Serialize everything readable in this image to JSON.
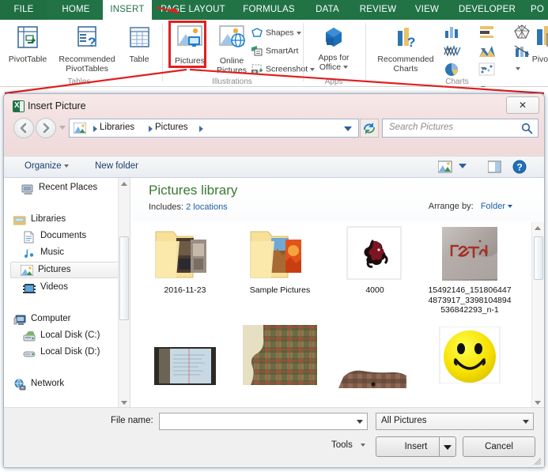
{
  "ribbon": {
    "tabs": [
      {
        "label": "FILE",
        "state": "file"
      },
      {
        "label": "HOME",
        "state": "normal"
      },
      {
        "label": "INSERT",
        "state": "active"
      },
      {
        "label": "PAGE LAYOUT",
        "state": "normal"
      },
      {
        "label": "FORMULAS",
        "state": "normal"
      },
      {
        "label": "DATA",
        "state": "normal"
      },
      {
        "label": "REVIEW",
        "state": "normal"
      },
      {
        "label": "VIEW",
        "state": "normal"
      },
      {
        "label": "DEVELOPER",
        "state": "normal"
      },
      {
        "label": "PO",
        "state": "normal"
      }
    ],
    "groups": [
      {
        "title": "Tables"
      },
      {
        "title": "Illustrations"
      },
      {
        "title": "Apps"
      },
      {
        "title": "Charts"
      }
    ],
    "buttons": {
      "pivot_table": "PivotTable",
      "recommended_pivot_1": "Recommended",
      "recommended_pivot_2": "PivotTables",
      "table": "Table",
      "pictures": "Pictures",
      "online_1": "Online",
      "online_2": "Pictures",
      "shapes": "Shapes",
      "smartart": "SmartArt",
      "screenshot": "Screenshot",
      "apps_1": "Apps for",
      "apps_2": "Office",
      "rec_charts_1": "Recommended",
      "rec_charts_2": "Charts",
      "pivotchart": "PivotCha"
    },
    "accent_green": "#217346",
    "highlight_color": "#e02020"
  },
  "dialog": {
    "title": "Insert Picture",
    "close_label": "✕",
    "address": {
      "crumbs": [
        "Libraries",
        "Pictures"
      ],
      "refresh_icon": "refresh-icon"
    },
    "search": {
      "placeholder": "Search Pictures"
    },
    "commandbar": {
      "organize": "Organize",
      "new_folder": "New folder",
      "view_icon": "view-icon",
      "preview_icon": "preview-pane-icon",
      "help_icon": "help-icon"
    },
    "navpane": {
      "items": [
        {
          "label": "Recent Places",
          "icon": "recent-places-icon",
          "indent": 1,
          "selected": false
        },
        {
          "label": "Libraries",
          "icon": "libraries-icon",
          "indent": 0,
          "selected": false
        },
        {
          "label": "Documents",
          "icon": "documents-icon",
          "indent": 1,
          "selected": false
        },
        {
          "label": "Music",
          "icon": "music-icon",
          "indent": 1,
          "selected": false
        },
        {
          "label": "Pictures",
          "icon": "pictures-icon",
          "indent": 1,
          "selected": true
        },
        {
          "label": "Videos",
          "icon": "videos-icon",
          "indent": 1,
          "selected": false
        },
        {
          "label": "Computer",
          "icon": "computer-icon",
          "indent": 0,
          "selected": false
        },
        {
          "label": "Local Disk (C:)",
          "icon": "drive-icon",
          "indent": 1,
          "selected": false
        },
        {
          "label": "Local Disk (D:)",
          "icon": "drive-icon",
          "indent": 1,
          "selected": false
        },
        {
          "label": "Network",
          "icon": "network-icon",
          "indent": 0,
          "selected": false
        }
      ]
    },
    "library": {
      "title": "Pictures library",
      "includes_label": "Includes:",
      "includes_value": "2 locations",
      "arrange_label": "Arrange by:",
      "arrange_value": "Folder"
    },
    "files": [
      {
        "name": "2016-11-23",
        "kind": "folder",
        "thumb": "folder-photos"
      },
      {
        "name": "Sample Pictures",
        "kind": "folder",
        "thumb": "folder-sample"
      },
      {
        "name": "4000",
        "kind": "image",
        "thumb": "dragon-logo"
      },
      {
        "name": "15492146_1518064474873917_3398104894536842293_n-1",
        "kind": "image",
        "thumb": "loctroi-photo"
      },
      {
        "name": "",
        "kind": "image",
        "thumb": "blue-paper"
      },
      {
        "name": "",
        "kind": "image",
        "thumb": "plaid-cutout"
      },
      {
        "name": "",
        "kind": "image",
        "thumb": "plaid-strip"
      },
      {
        "name": "",
        "kind": "image",
        "thumb": "smiley-face"
      }
    ],
    "footer": {
      "file_name_label": "File name:",
      "file_name_value": "",
      "file_type_value": "All Pictures",
      "tools": "Tools",
      "insert": "Insert",
      "cancel": "Cancel"
    }
  }
}
